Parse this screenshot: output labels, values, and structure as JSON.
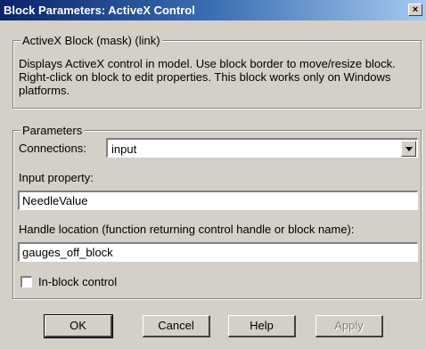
{
  "window": {
    "title": "Block Parameters: ActiveX Control",
    "close_glyph": "×"
  },
  "block_group": {
    "legend": "ActiveX Block (mask) (link)",
    "description": "Displays ActiveX control in model. Use block border to move/resize block. Right-click on block to edit properties. This block works only on Windows platforms."
  },
  "params_group": {
    "legend": "Parameters",
    "connections_label": "Connections:",
    "connections_value": "input",
    "input_property_label": "Input property:",
    "input_property_value": "NeedleValue",
    "handle_location_label": "Handle location (function returning control handle or block name):",
    "handle_location_value": "gauges_off_block",
    "inblock_label": "In-block control",
    "inblock_checked": false
  },
  "buttons": {
    "ok": "OK",
    "cancel": "Cancel",
    "help": "Help",
    "apply": "Apply"
  }
}
